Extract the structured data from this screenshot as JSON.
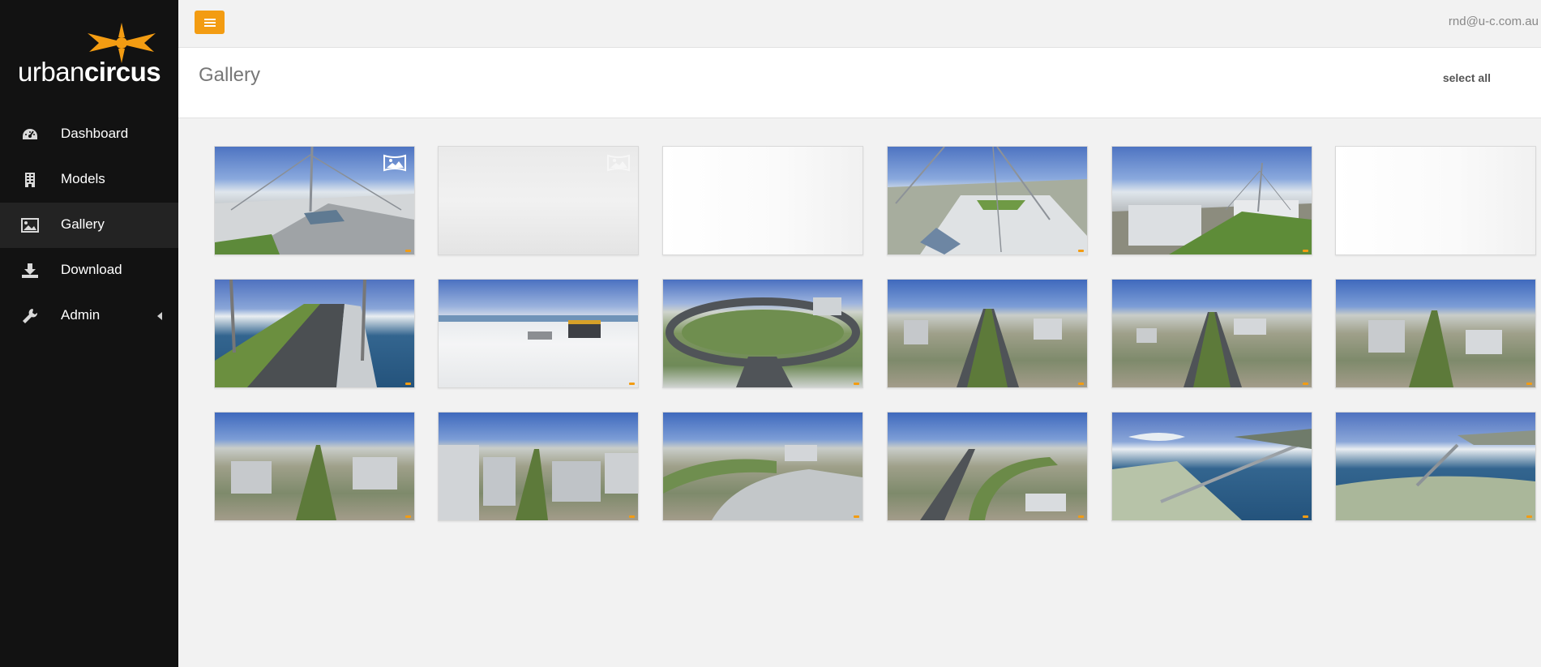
{
  "brand": {
    "logo_light": "urban",
    "logo_bold": "circus",
    "accent_color": "#f39c12"
  },
  "sidebar": {
    "items": [
      {
        "label": "Dashboard",
        "icon": "dashboard-icon",
        "active": false
      },
      {
        "label": "Models",
        "icon": "building-icon",
        "active": false
      },
      {
        "label": "Gallery",
        "icon": "image-icon",
        "active": true
      },
      {
        "label": "Download",
        "icon": "download-icon",
        "active": false
      },
      {
        "label": "Admin",
        "icon": "wrench-icon",
        "active": false,
        "has_submenu": true
      }
    ]
  },
  "topbar": {
    "menu_button_icon": "hamburger-icon",
    "user_email": "rnd@u-c.com.au"
  },
  "header": {
    "page_title": "Gallery",
    "select_all_label": "select all"
  },
  "gallery": {
    "thumbnails": [
      {
        "scene": "flagpole-roof-plaza",
        "style": "skyground",
        "badge": true,
        "badge_faded": false
      },
      {
        "scene": "foggy-blank",
        "style": "fog",
        "badge": true,
        "badge_faded": true
      },
      {
        "scene": "blank",
        "style": "blank",
        "badge": false
      },
      {
        "scene": "flagpole-roof-pyramid",
        "style": "skyground",
        "badge": false
      },
      {
        "scene": "flagpole-lawn-roof",
        "style": "skyground",
        "badge": false
      },
      {
        "scene": "blank",
        "style": "blank",
        "badge": false
      },
      {
        "scene": "bridge-over-lake",
        "style": "waterview",
        "badge": false
      },
      {
        "scene": "white-roof-waterfront",
        "style": "roof",
        "badge": false
      },
      {
        "scene": "roundabout",
        "style": "roundabout",
        "badge": false
      },
      {
        "scene": "city-avenue-1",
        "style": "cityview",
        "badge": false
      },
      {
        "scene": "city-avenue-2",
        "style": "cityview",
        "badge": false
      },
      {
        "scene": "city-avenue-3",
        "style": "cityview",
        "badge": false
      },
      {
        "scene": "city-avenue-4",
        "style": "cityview",
        "badge": false
      },
      {
        "scene": "city-avenue-5",
        "style": "cityview",
        "badge": false
      },
      {
        "scene": "city-curved-road",
        "style": "cityview",
        "badge": false
      },
      {
        "scene": "city-interchange",
        "style": "cityview",
        "badge": false
      },
      {
        "scene": "lake-bridge-aerial",
        "style": "waterview",
        "badge": false
      },
      {
        "scene": "lake-bridge-wide",
        "style": "waterview",
        "badge": false
      }
    ]
  }
}
